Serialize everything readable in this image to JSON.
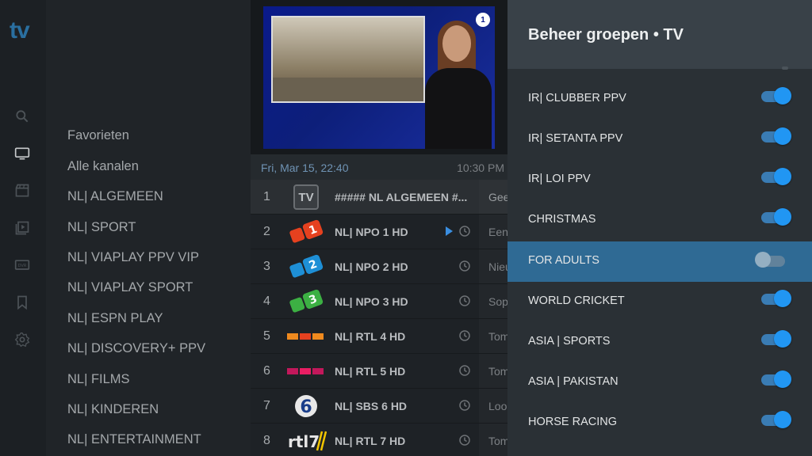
{
  "app": {
    "logo": "tv",
    "colors": {
      "accent": "#2196f3",
      "focus_row": "#2f6a94",
      "logo": "#2a6fa0"
    }
  },
  "rail": {
    "icons": [
      "search-icon",
      "tv-icon",
      "movie-icon",
      "series-icon",
      "dvr-icon",
      "bookmark-icon",
      "settings-icon"
    ]
  },
  "groups": [
    "Favorieten",
    "Alle kanalen",
    "NL| ALGEMEEN",
    "NL| SPORT",
    "NL| VIAPLAY PPV VIP",
    "NL| VIAPLAY SPORT",
    "NL| ESPN PLAY",
    "NL| DISCOVERY+ PPV",
    "NL| FILMS",
    "NL| KINDEREN",
    "NL| ENTERTAINMENT"
  ],
  "preview": {
    "channel_bug": "1"
  },
  "epg": {
    "date": "Fri, Mar 15, 22:40",
    "time": "10:30 PM"
  },
  "channels": [
    {
      "num": "1",
      "logo": "TV",
      "name": "##### NL ALGEMEEN #...",
      "prog": "Gee"
    },
    {
      "num": "2",
      "logo": "npo1",
      "name": "NL| NPO 1 HD",
      "prog": "Een"
    },
    {
      "num": "3",
      "logo": "npo2",
      "name": "NL| NPO 2 HD",
      "prog": "Nieu"
    },
    {
      "num": "4",
      "logo": "npo3",
      "name": "NL| NPO 3 HD",
      "prog": "Sop"
    },
    {
      "num": "5",
      "logo": "rtl4",
      "name": "NL| RTL 4 HD",
      "prog": "Tom"
    },
    {
      "num": "6",
      "logo": "rtl5",
      "name": "NL| RTL 5 HD",
      "prog": "Tom"
    },
    {
      "num": "7",
      "logo": "sbs6",
      "name": "NL| SBS 6 HD",
      "prog": "Loo"
    },
    {
      "num": "8",
      "logo": "rtl7",
      "name": "NL| RTL 7 HD",
      "prog": "Tom"
    }
  ],
  "panel": {
    "title": "Beheer groepen  •  TV",
    "toggles": [
      {
        "label": "IR| CLUBBER PPV",
        "on": true
      },
      {
        "label": "IR| SETANTA PPV",
        "on": true
      },
      {
        "label": "IR| LOI PPV",
        "on": true
      },
      {
        "label": "CHRISTMAS",
        "on": true
      },
      {
        "label": "FOR ADULTS",
        "on": false
      },
      {
        "label": "WORLD CRICKET",
        "on": true
      },
      {
        "label": "ASIA | SPORTS",
        "on": true
      },
      {
        "label": "ASIA | PAKISTAN",
        "on": true
      },
      {
        "label": "HORSE RACING",
        "on": true
      }
    ]
  }
}
